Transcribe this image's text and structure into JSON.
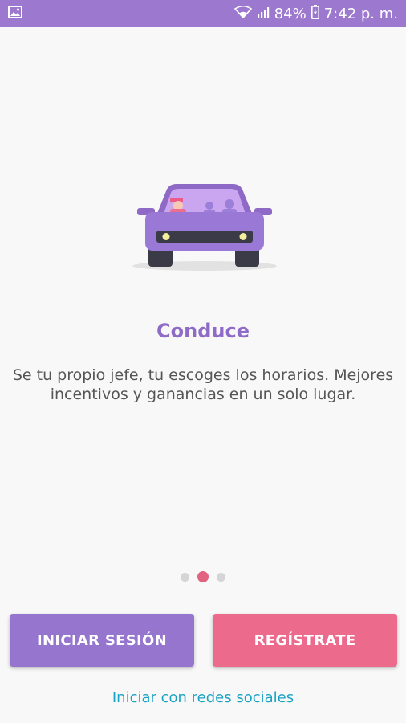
{
  "status_bar": {
    "notification_icon": "gallery-icon",
    "wifi_icon": "wifi-icon",
    "signal_icon": "signal-icon",
    "battery_percent": "84%",
    "battery_icon": "battery-charging-icon",
    "time": "7:42 p. m.",
    "background": "#9c79cf"
  },
  "onboarding": {
    "illustration": "car-illustration",
    "title": "Conduce",
    "description": "Se tu propio jefe, tu escoges los horarios. Mejores incentivos y ganancias en un solo lugar.",
    "pager": {
      "count": 3,
      "active_index": 1
    }
  },
  "actions": {
    "login_label": "INICIAR SESIÓN",
    "register_label": "REGÍSTRATE",
    "social_label": "Iniciar con redes sociales"
  },
  "colors": {
    "primary": "#9575cd",
    "accent": "#ec6a8c",
    "link": "#1ba3c2",
    "title": "#8e6bc6"
  }
}
